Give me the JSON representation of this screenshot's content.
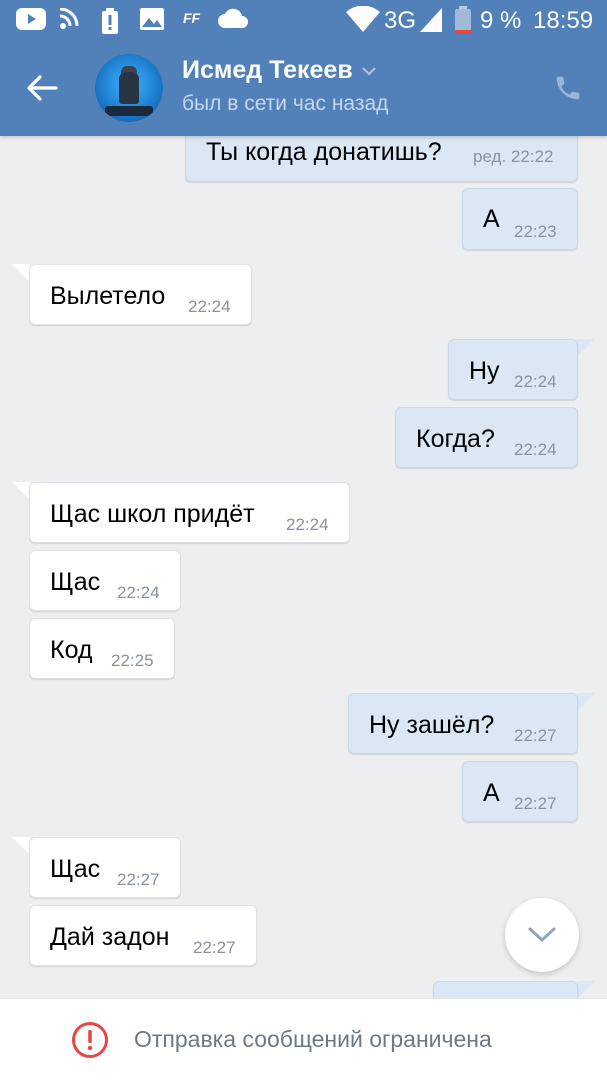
{
  "status_bar": {
    "network": "3G",
    "battery": "9 %",
    "time": "18:59",
    "icons": [
      "youtube-icon",
      "rss-icon",
      "battery-alert-icon",
      "image-icon",
      "ff-icon",
      "cloud-icon",
      "wifi-icon",
      "signal-icon",
      "battery-icon"
    ],
    "ff_label": "FF"
  },
  "header": {
    "name": "Исмед Текеев",
    "status": "был в сети час назад"
  },
  "messages": [
    {
      "dir": "out",
      "text": "Ты когда донатишь?",
      "time": "ред. 22:22"
    },
    {
      "dir": "out",
      "text": "А",
      "time": "22:23"
    },
    {
      "dir": "in",
      "text": "Вылетело",
      "time": "22:24"
    },
    {
      "dir": "out",
      "text": "Ну",
      "time": "22:24"
    },
    {
      "dir": "out",
      "text": "Когда?",
      "time": "22:24"
    },
    {
      "dir": "in",
      "text": "Щас школ придёт",
      "time": "22:24"
    },
    {
      "dir": "in",
      "text": "Щас",
      "time": "22:24"
    },
    {
      "dir": "in",
      "text": "Код",
      "time": "22:25"
    },
    {
      "dir": "out",
      "text": "Ну зашёл?",
      "time": "22:27"
    },
    {
      "dir": "out",
      "text": "А",
      "time": "22:27"
    },
    {
      "dir": "in",
      "text": "Щас",
      "time": "22:27"
    },
    {
      "dir": "in",
      "text": "Дай задон",
      "time": "22:27"
    }
  ],
  "footer": {
    "text": "Отправка сообщений ограничена"
  },
  "colors": {
    "header": "#5181b8",
    "background": "#edeef0",
    "incoming_bubble": "#ffffff",
    "outgoing_bubble": "#dce7f5",
    "warning": "#e64646"
  }
}
